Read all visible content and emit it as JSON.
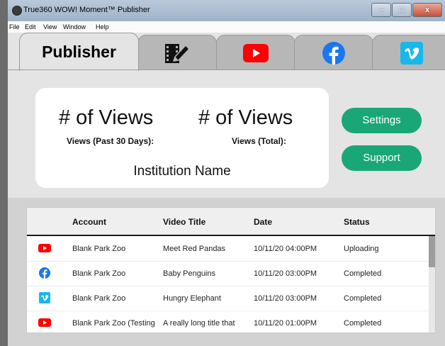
{
  "window": {
    "title": "True360 WOW! Moment™ Publisher",
    "minimize": "–",
    "maximize": "□",
    "close": "x"
  },
  "menu": [
    "File",
    "Edit",
    "View",
    "Window",
    "Help"
  ],
  "tabs": [
    {
      "label": "Publisher",
      "icon": "publisher"
    },
    {
      "label": "",
      "icon": "video-edit-icon"
    },
    {
      "label": "",
      "icon": "youtube-icon"
    },
    {
      "label": "",
      "icon": "facebook-icon"
    },
    {
      "label": "",
      "icon": "vimeo-icon"
    }
  ],
  "stats": {
    "views_30_value": "# of Views",
    "views_30_label": "Views (Past 30 Days):",
    "views_total_value": "# of Views",
    "views_total_label": "Views (Total):",
    "institution": "Institution Name"
  },
  "buttons": {
    "settings": "Settings",
    "support": "Support"
  },
  "table": {
    "headers": [
      "Account",
      "Video Title",
      "Date",
      "Status"
    ],
    "rows": [
      {
        "platform": "youtube",
        "account": "Blank Park Zoo",
        "title": "Meet Red Pandas",
        "date": "10/11/20 04:00PM",
        "status": "Uploading"
      },
      {
        "platform": "facebook",
        "account": "Blank Park Zoo",
        "title": "Baby Penguins",
        "date": "10/11/20 03:00PM",
        "status": "Completed"
      },
      {
        "platform": "vimeo",
        "account": "Blank Park Zoo",
        "title": "Hungry Elephant",
        "date": "10/11/20 03:00PM",
        "status": "Completed"
      },
      {
        "platform": "youtube",
        "account": "Blank Park Zoo (Testing",
        "title": "A really long title that",
        "date": "10/11/20 01:00PM",
        "status": "Completed"
      }
    ]
  },
  "colors": {
    "accent_green": "#1aa777",
    "youtube_red": "#ff0000",
    "facebook_blue": "#1877f2",
    "vimeo_blue": "#1ab7ea"
  }
}
